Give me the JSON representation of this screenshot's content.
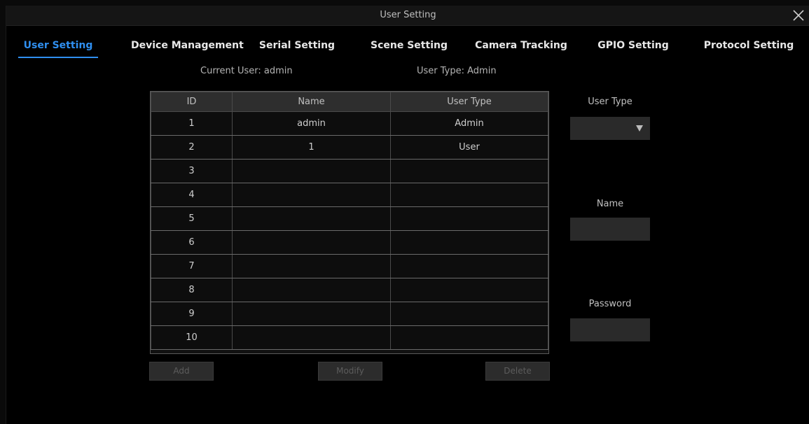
{
  "window": {
    "title": "User Setting"
  },
  "tabs": [
    {
      "label": "User Setting",
      "active": true
    },
    {
      "label": "Device Management"
    },
    {
      "label": "Serial Setting"
    },
    {
      "label": "Scene Setting"
    },
    {
      "label": "Camera Tracking"
    },
    {
      "label": "GPIO Setting"
    },
    {
      "label": "Protocol Setting"
    }
  ],
  "info": {
    "current_user": "Current User:  admin",
    "user_type": "User Type:  Admin"
  },
  "table": {
    "headers": [
      "ID",
      "Name",
      "User Type"
    ],
    "rows": [
      [
        "1",
        "admin",
        "Admin"
      ],
      [
        "2",
        "1",
        "User"
      ],
      [
        "3",
        "",
        ""
      ],
      [
        "4",
        "",
        ""
      ],
      [
        "5",
        "",
        ""
      ],
      [
        "6",
        "",
        ""
      ],
      [
        "7",
        "",
        ""
      ],
      [
        "8",
        "",
        ""
      ],
      [
        "9",
        "",
        ""
      ],
      [
        "10",
        "",
        ""
      ]
    ]
  },
  "side": {
    "user_type_label": "User Type",
    "user_type_value": "",
    "name_label": "Name",
    "name_value": "",
    "password_label": "Password",
    "password_value": ""
  },
  "buttons": {
    "add": "Add",
    "modify": "Modify",
    "delete": "Delete"
  },
  "colors": {
    "accent": "#2f8ff0",
    "background": "#000000",
    "header_bg": "#2e2e2e",
    "field_bg": "#2a2a2a"
  },
  "icons": {
    "close": "close-icon",
    "dropdown": "caret-down-icon"
  }
}
